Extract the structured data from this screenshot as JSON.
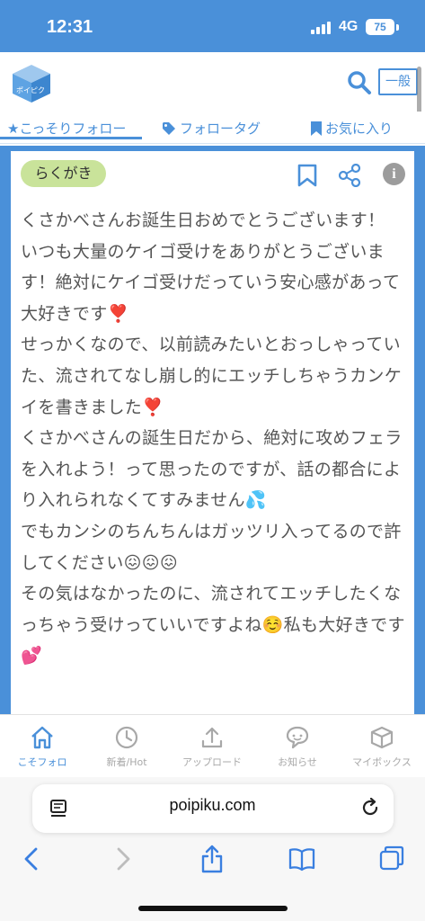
{
  "status_bar": {
    "time": "12:31",
    "network": "4G",
    "battery": "75"
  },
  "header": {
    "mode_label": "一般",
    "logo_text": "ポイピク"
  },
  "tabs": [
    {
      "label": "★こっそりフォロー"
    },
    {
      "label": "フォロータグ"
    },
    {
      "label": "お気に入り"
    }
  ],
  "post": {
    "tag": "らくがき",
    "lines": [
      "くさかべさんお誕生日おめでとうございます！",
      "いつも大量のケイゴ受けをありがとうございます！絶対にケイゴ受けだっていう安心感があって大好きです❣️",
      "せっかくなので、以前読みたいとおっしゃっていた、流されてなし崩し的にエッチしちゃうカンケイを書きました❣️",
      "くさかべさんの誕生日だから、絶対に攻めフェラを入れよう！って思ったのですが、話の都合により入れられなくてすみません💦",
      "でもカンシのちんちんはガッツリ入ってるので許してください😖😖😖",
      "その気はなかったのに、流されてエッチしたくなっちゃう受けっていいですよね☺️私も大好きです💕"
    ]
  },
  "bottom_nav": [
    {
      "label": "こそフォロ",
      "icon": "home-icon",
      "active": true
    },
    {
      "label": "新着/Hot",
      "icon": "clock-icon",
      "active": false
    },
    {
      "label": "アップロード",
      "icon": "upload-icon",
      "active": false
    },
    {
      "label": "お知らせ",
      "icon": "notification-icon",
      "active": false
    },
    {
      "label": "マイボックス",
      "icon": "box-icon",
      "active": false
    }
  ],
  "browser": {
    "url": "poipiku.com"
  },
  "colors": {
    "accent": "#4a90d9",
    "tag_bg": "#c9e39a"
  }
}
